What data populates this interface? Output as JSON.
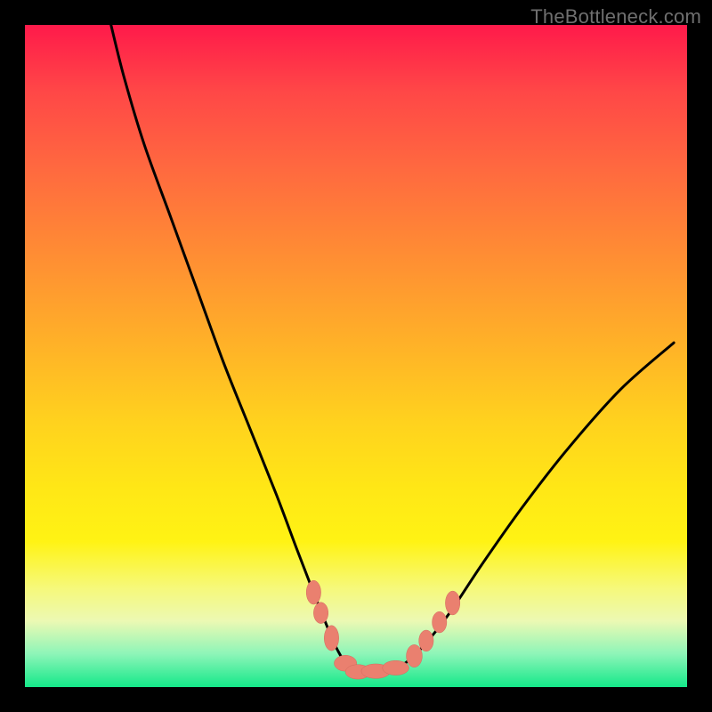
{
  "watermark": "TheBottleneck.com",
  "colors": {
    "background": "#000000",
    "curve_stroke": "#000000",
    "marker_fill": "#ea806f",
    "marker_stroke": "#d46a5d"
  },
  "chart_data": {
    "type": "line",
    "title": "",
    "xlabel": "",
    "ylabel": "",
    "xlim": [
      0,
      100
    ],
    "ylim": [
      0,
      100
    ],
    "grid": false,
    "legend": false,
    "series": [
      {
        "name": "curve",
        "x": [
          13,
          15,
          18,
          22,
          26,
          30,
          34,
          38,
          41,
          43.5,
          45.5,
          47,
          48.5,
          50,
          51.5,
          53,
          55,
          57,
          60,
          64,
          69,
          75,
          82,
          90,
          98
        ],
        "values": [
          100,
          92,
          82,
          71,
          60,
          49,
          39,
          29,
          21,
          14.5,
          9.5,
          6,
          3.5,
          2.3,
          2.3,
          2.4,
          2.6,
          3.3,
          6,
          11,
          18.5,
          27,
          36,
          45,
          52
        ]
      }
    ],
    "markers": [
      {
        "x": 43.6,
        "y": 14.3,
        "rx": 1.1,
        "ry": 1.8
      },
      {
        "x": 44.7,
        "y": 11.2,
        "rx": 1.1,
        "ry": 1.6
      },
      {
        "x": 46.3,
        "y": 7.4,
        "rx": 1.1,
        "ry": 1.9
      },
      {
        "x": 48.4,
        "y": 3.6,
        "rx": 1.7,
        "ry": 1.2
      },
      {
        "x": 50.3,
        "y": 2.3,
        "rx": 1.9,
        "ry": 1.1
      },
      {
        "x": 53.0,
        "y": 2.4,
        "rx": 2.2,
        "ry": 1.1
      },
      {
        "x": 56.0,
        "y": 2.9,
        "rx": 2.0,
        "ry": 1.1
      },
      {
        "x": 58.8,
        "y": 4.7,
        "rx": 1.2,
        "ry": 1.7
      },
      {
        "x": 60.6,
        "y": 7.0,
        "rx": 1.1,
        "ry": 1.6
      },
      {
        "x": 62.6,
        "y": 9.8,
        "rx": 1.1,
        "ry": 1.6
      },
      {
        "x": 64.6,
        "y": 12.7,
        "rx": 1.1,
        "ry": 1.8
      }
    ]
  }
}
